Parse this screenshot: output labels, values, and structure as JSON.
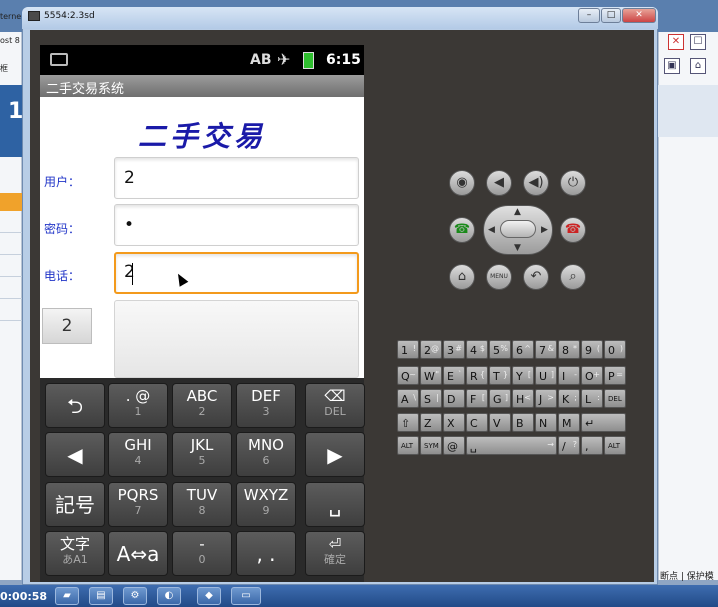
{
  "background_window": {
    "left_captions": [
      "terne",
      "ost 8",
      "框"
    ],
    "left_big_char": "1",
    "right_status_text": "断点 | 保护模"
  },
  "emulator_window": {
    "title": "5554:2.3sd",
    "minimize": "–",
    "maximize": "□",
    "close": "✕"
  },
  "status_bar": {
    "network": "AB",
    "time": "6:15",
    "icons": [
      "message-icon",
      "airplane-icon",
      "battery-icon"
    ]
  },
  "app": {
    "title": "二手交易系统",
    "logo": "二手交易",
    "form": {
      "user_label": "用户：",
      "user_value": "2",
      "password_label": "密码：",
      "password_value": "•",
      "phone_label": "电话：",
      "phone_value": "2"
    },
    "suggestion": "2"
  },
  "soft_keyboard": {
    "rows": [
      [
        {
          "main": "⮌",
          "sub": ""
        },
        {
          "main": ". @",
          "sub": "1"
        },
        {
          "main": "ABC",
          "sub": "2"
        },
        {
          "main": "DEF",
          "sub": "3"
        },
        {
          "main": "⌫",
          "sub": "DEL"
        }
      ],
      [
        {
          "main": "◀",
          "sub": ""
        },
        {
          "main": "GHI",
          "sub": "4"
        },
        {
          "main": "JKL",
          "sub": "5"
        },
        {
          "main": "MNO",
          "sub": "6"
        },
        {
          "main": "▶",
          "sub": ""
        }
      ],
      [
        {
          "main": "記号",
          "sub": ""
        },
        {
          "main": "PQRS",
          "sub": "7"
        },
        {
          "main": "TUV",
          "sub": "8"
        },
        {
          "main": "WXYZ",
          "sub": "9"
        },
        {
          "main": "␣",
          "sub": ""
        }
      ],
      [
        {
          "main": "文字",
          "sub": "あA1"
        },
        {
          "main": "A⇔a",
          "sub": ""
        },
        {
          "main": "-",
          "sub": "0"
        },
        {
          "main": ", .",
          "sub": ""
        },
        {
          "main": "⏎",
          "sub": "確定"
        }
      ]
    ]
  },
  "emulator_controls": {
    "camera": "◉",
    "vol_down": "◀",
    "vol_up": "◀)",
    "power": "⏻",
    "call": "☎",
    "end_call": "☎",
    "home": "⌂",
    "menu": "MENU",
    "back": "↶",
    "search": "⌕"
  },
  "hardware_keyboard": {
    "row1": [
      [
        "1",
        "!"
      ],
      [
        "2",
        "@"
      ],
      [
        "3",
        "#"
      ],
      [
        "4",
        "$"
      ],
      [
        "5",
        "%"
      ],
      [
        "6",
        "^"
      ],
      [
        "7",
        "&"
      ],
      [
        "8",
        "*"
      ],
      [
        "9",
        "("
      ],
      [
        "0",
        ")"
      ]
    ],
    "row2": [
      [
        "Q",
        "~"
      ],
      [
        "W",
        "\""
      ],
      [
        "E",
        "`"
      ],
      [
        "R",
        "{"
      ],
      [
        "T",
        "}"
      ],
      [
        "Y",
        "["
      ],
      [
        "U",
        "]"
      ],
      [
        "I",
        "-"
      ],
      [
        "O",
        "+"
      ],
      [
        "P",
        "="
      ]
    ],
    "row3": [
      [
        "A",
        "\\"
      ],
      [
        "S",
        "|"
      ],
      [
        "D",
        ""
      ],
      [
        "F",
        "["
      ],
      [
        "G",
        "]"
      ],
      [
        "H",
        "<"
      ],
      [
        "J",
        ">"
      ],
      [
        "K",
        ";"
      ],
      [
        "L",
        ":"
      ],
      [
        "DEL",
        ""
      ]
    ],
    "row4": [
      [
        "⇧",
        ""
      ],
      [
        "Z",
        ""
      ],
      [
        "X",
        ""
      ],
      [
        "C",
        ""
      ],
      [
        "V",
        ""
      ],
      [
        "B",
        ""
      ],
      [
        "N",
        ""
      ],
      [
        "M",
        ""
      ],
      [
        "↵",
        ""
      ]
    ],
    "row5": [
      [
        "ALT",
        ""
      ],
      [
        "SYM",
        ""
      ],
      [
        "@",
        ""
      ],
      [
        "␣",
        "→"
      ],
      [
        "/",
        "?"
      ],
      [
        ",",
        ""
      ],
      [
        "ALT",
        ""
      ]
    ]
  },
  "taskbar": {
    "time": "0:00:58"
  }
}
